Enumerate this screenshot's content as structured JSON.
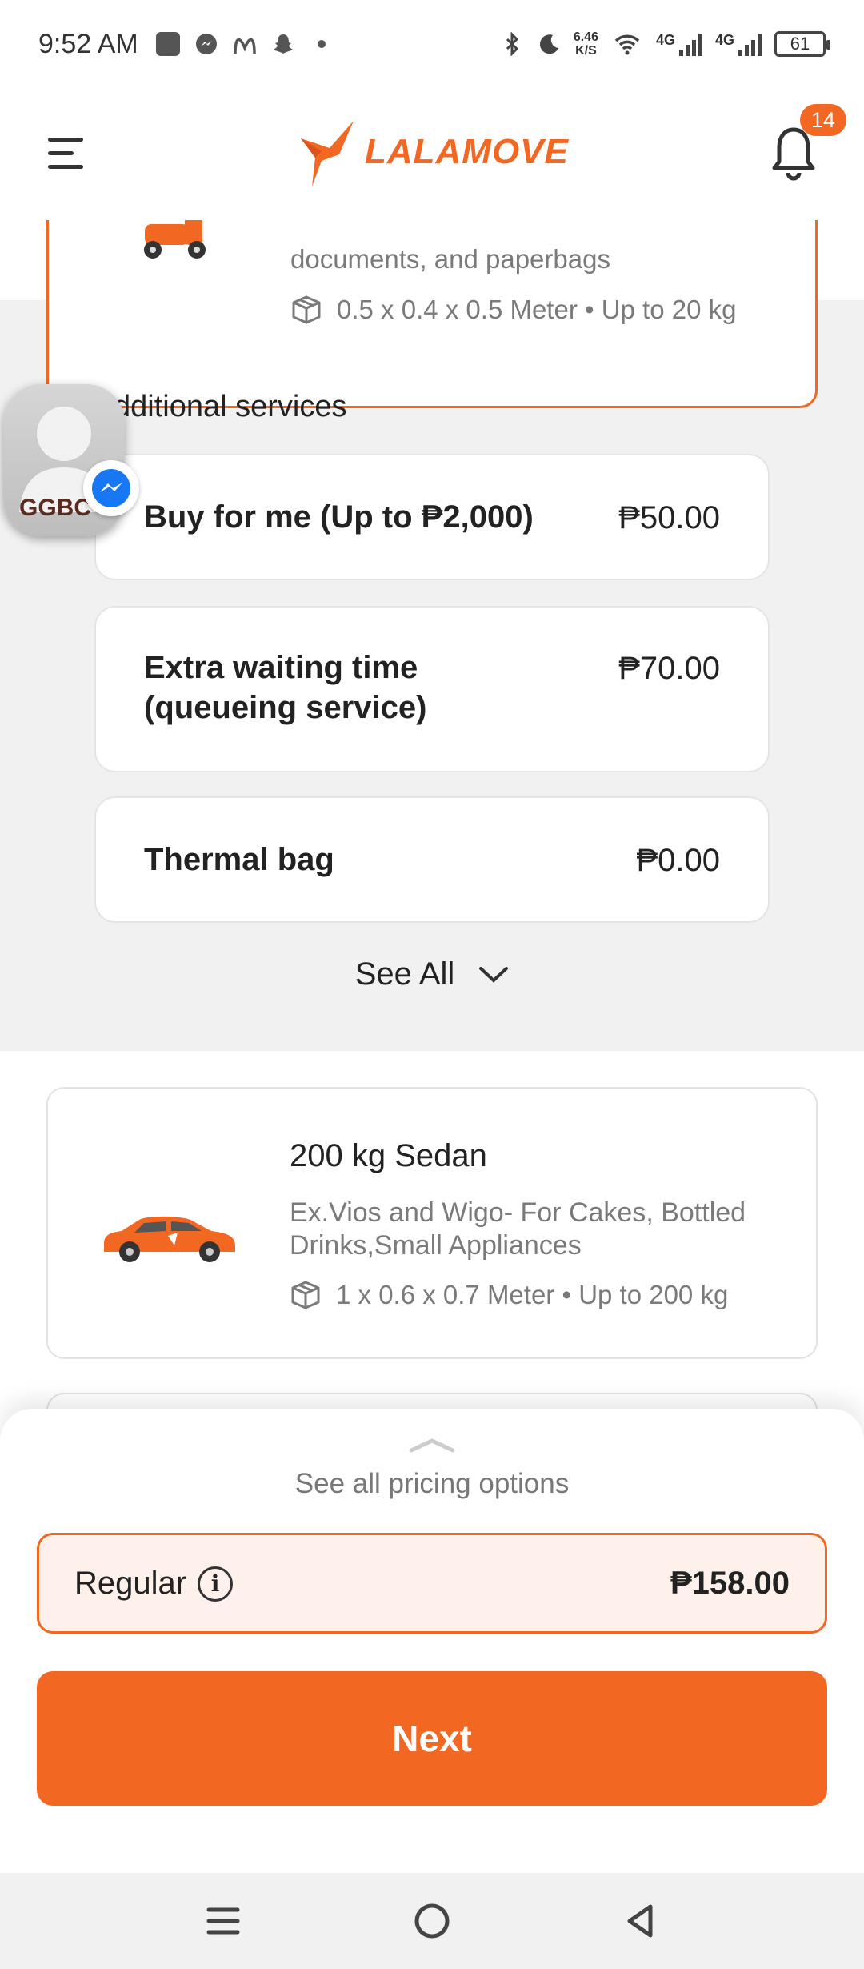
{
  "status_bar": {
    "time": "9:52 AM",
    "net_speed_value": "6.46",
    "net_speed_unit": "K/S",
    "signal_1": "4G",
    "signal_2": "4G",
    "battery": "61"
  },
  "app_header": {
    "logo_text": "LALAMOVE",
    "notification_count": "14"
  },
  "top_vehicle": {
    "description_tail": "documents, and paperbags",
    "dimensions": "0.5 x 0.4 x 0.5 Meter • Up to 20 kg"
  },
  "chat_head": {
    "caption": "GGBC"
  },
  "additional_services": {
    "title_visible": "dditional services",
    "items": [
      {
        "name": "Buy for me (Up to ₱2,000)",
        "price": "₱50.00"
      },
      {
        "name": "Extra waiting time (queueing service)",
        "price": "₱70.00"
      },
      {
        "name": "Thermal bag",
        "price": "₱0.00"
      }
    ],
    "see_all_label": "See All"
  },
  "sedan_vehicle": {
    "title": "200 kg Sedan",
    "description": "Ex.Vios and Wigo- For Cakes, Bottled Drinks,Small Appliances",
    "dimensions": "1 x 0.6 x 0.7 Meter • Up to 200 kg"
  },
  "bottom_sheet": {
    "see_pricing_label": "See all pricing options",
    "regular_label": "Regular",
    "regular_price": "₱158.00",
    "next_label": "Next"
  },
  "colors": {
    "brand_orange": "#f26722",
    "regular_bg": "#fef0ea"
  }
}
